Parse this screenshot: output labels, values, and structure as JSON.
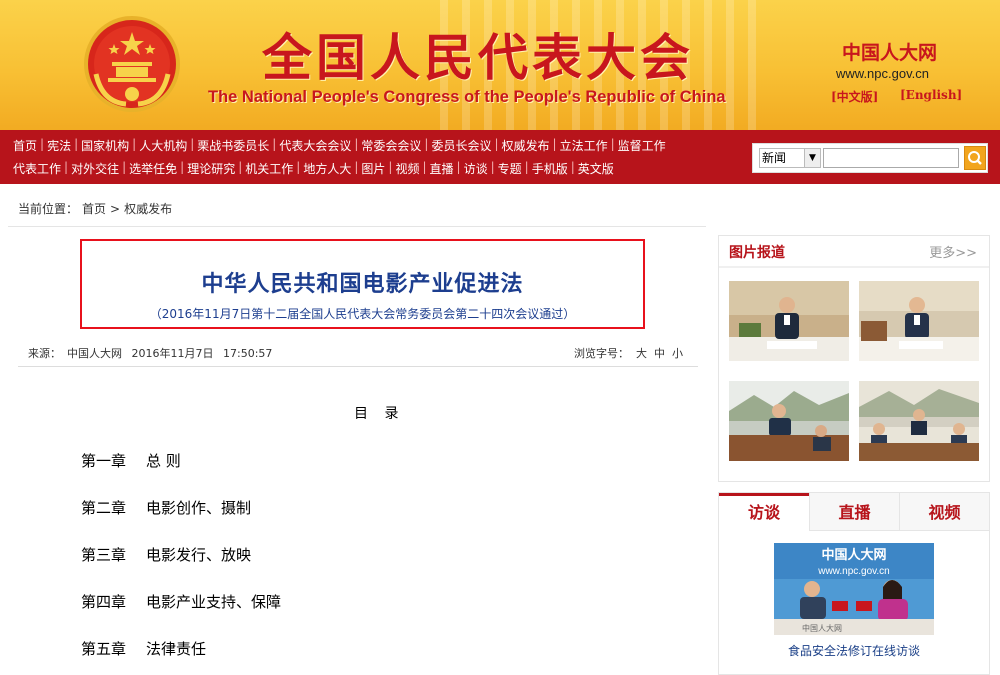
{
  "header": {
    "title_cn": "全国人民代表大会",
    "title_en": "The National People's Congress of the People's Republic of China",
    "site_logo": "中国人大网",
    "site_url": "www.npc.gov.cn",
    "lang_cn": "[中文版]",
    "lang_en": "[English]",
    "brand_red": "#c8161d",
    "brand_gold": "#f8c034"
  },
  "nav": {
    "row1": [
      "首页",
      "宪法",
      "国家机构",
      "人大机构",
      "栗战书委员长",
      "代表大会会议",
      "常委会会议",
      "委员长会议",
      "权威发布",
      "立法工作",
      "监督工作"
    ],
    "row2": [
      "代表工作",
      "对外交往",
      "选举任免",
      "理论研究",
      "机关工作",
      "地方人大",
      "图片",
      "视频",
      "直播",
      "访谈",
      "专题",
      "手机版",
      "英文版"
    ]
  },
  "search": {
    "category": "新闻",
    "query": "",
    "button_icon": "search-icon"
  },
  "breadcrumb": {
    "label": "当前位置：",
    "home": "首页",
    "sep": ">",
    "current": "权威发布"
  },
  "article": {
    "title": "中华人民共和国电影产业促进法",
    "subtitle": "（2016年11月7日第十二届全国人民代表大会常务委员会第二十四次会议通过）",
    "source_label": "来源：",
    "source": "中国人大网",
    "date": "2016年11月7日",
    "time": "17:50:57",
    "fontsize_label": "浏览字号：",
    "fontsize_large": "大",
    "fontsize_medium": "中",
    "fontsize_small": "小",
    "toc_title": "目 录",
    "chapters": [
      {
        "num": "第一章",
        "title": "总 则"
      },
      {
        "num": "第二章",
        "title": "电影创作、摄制"
      },
      {
        "num": "第三章",
        "title": "电影发行、放映"
      },
      {
        "num": "第四章",
        "title": "电影产业支持、保障"
      },
      {
        "num": "第五章",
        "title": "法律责任"
      }
    ]
  },
  "sidebar": {
    "photo_title": "图片报道",
    "more": "更多>>",
    "tabs": [
      "访谈",
      "直播",
      "视频"
    ],
    "interview_caption": "食品安全法修订在线访谈",
    "interview_logo": "中国人大网",
    "interview_url": "www.npc.gov.cn",
    "interview_bg": "中国人大网"
  }
}
